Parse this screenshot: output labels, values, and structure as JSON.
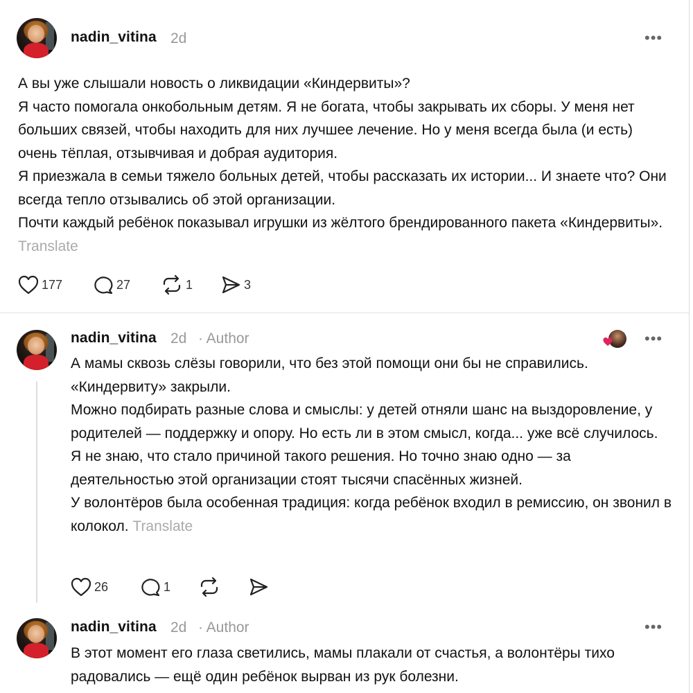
{
  "posts": [
    {
      "username": "nadin_vitina",
      "time": "2d",
      "paragraphs": [
        "А вы уже слышали новость о ликвидации «Киндервиты»?",
        "Я часто помогала онкобольным детям. Я не богата, чтобы закрывать их сборы. У меня нет больших связей, чтобы находить для них лучшее лечение. Но у меня всегда была (и есть) очень тёплая, отзывчивая и добрая аудитория.",
        "Я приезжала в семьи тяжело больных детей, чтобы рассказать их истории... И знаете что? Они всегда тепло отзывались об этой организации."
      ],
      "last_paragraph": "Почти каждый ребёнок показывал игрушки из жёлтого брендированного пакета «Киндервиты».",
      "translate": "Translate",
      "likes": "177",
      "comments": "27",
      "reposts": "1",
      "shares": "3"
    },
    {
      "username": "nadin_vitina",
      "time": "2d",
      "author_tag": "· Author",
      "paragraphs": [
        "А мамы сквозь слёзы говорили, что без этой помощи они бы не справились. «Киндервиту» закрыли.",
        "Можно подбирать разные слова и смыслы: у детей отняли шанс на выздоровление, у родителей — поддержку и опору. Но есть ли в этом смысл, когда... уже всё случилось.",
        "Я не знаю, что стало причиной такого решения. Но точно знаю одно — за деятельностью этой организации стоят тысячи спасённых жизней."
      ],
      "last_paragraph": "У волонтёров была особенная традиция: когда ребёнок входил в ремиссию, он звонил в колокол.",
      "translate": "Translate",
      "likes": "26",
      "comments": "1"
    },
    {
      "username": "nadin_vitina",
      "time": "2d",
      "author_tag": "· Author",
      "paragraphs": [
        "В этот момент его глаза светились, мамы плакали от счастья, а волонтёры тихо радовались — ещё один ребёнок вырван из рук болезни."
      ]
    }
  ],
  "icons": {
    "like": "heart-icon",
    "comment": "comment-bubble-icon",
    "repost": "repost-icon",
    "share": "send-icon",
    "more": "more-options-icon"
  },
  "colors": {
    "liked_heart": "#e0245e",
    "muted_text": "#999999",
    "divider": "#e3e3e3"
  }
}
